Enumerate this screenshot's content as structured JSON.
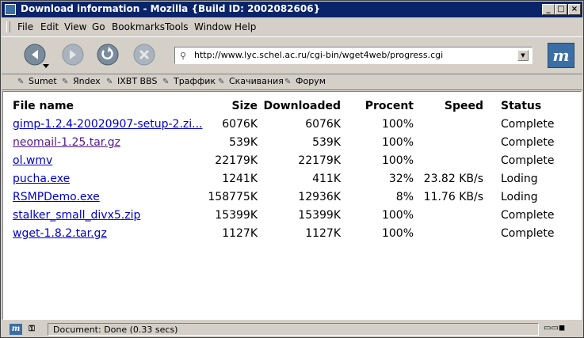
{
  "window": {
    "title": "Download information - Mozilla {Build ID: 2002082606}"
  },
  "menu": [
    "File",
    "Edit",
    "View",
    "Go",
    "Bookmarks",
    "Tools",
    "Window",
    "Help"
  ],
  "navigation": {
    "back_icon": "back-arrow-icon",
    "forward_icon": "forward-arrow-icon",
    "reload_icon": "reload-icon",
    "stop_icon": "stop-icon",
    "url": "http://www.lyc.schel.ac.ru/cgi-bin/wget4web/progress.cgi"
  },
  "bookmarks": [
    "Sumet",
    "Яndex",
    "IXBT BBS",
    "Траффик",
    "Скачивания",
    "Форум"
  ],
  "table": {
    "headers": {
      "name": "File name",
      "size": "Size",
      "downloaded": "Downloaded",
      "percent": "Procent",
      "speed": "Speed",
      "status": "Status"
    },
    "rows": [
      {
        "name": "gimp-1.2.4-20020907-setup-2.zi...",
        "size": "6076K",
        "downloaded": "6076K",
        "percent": "100%",
        "speed": "",
        "status": "Complete",
        "visited": false
      },
      {
        "name": "neomail-1.25.tar.gz",
        "size": "539K",
        "downloaded": "539K",
        "percent": "100%",
        "speed": "",
        "status": "Complete",
        "visited": true
      },
      {
        "name": "ol.wmv",
        "size": "22179K",
        "downloaded": "22179K",
        "percent": "100%",
        "speed": "",
        "status": "Complete",
        "visited": false
      },
      {
        "name": "pucha.exe",
        "size": "1241K",
        "downloaded": "411K",
        "percent": "32%",
        "speed": "23.82 KB/s",
        "status": "Loding",
        "visited": false
      },
      {
        "name": "RSMPDemo.exe",
        "size": "158775K",
        "downloaded": "12936K",
        "percent": "8%",
        "speed": "11.76 KB/s",
        "status": "Loding",
        "visited": false
      },
      {
        "name": "stalker_small_divx5.zip",
        "size": "15399K",
        "downloaded": "15399K",
        "percent": "100%",
        "speed": "",
        "status": "Complete",
        "visited": false
      },
      {
        "name": "wget-1.8.2.tar.gz",
        "size": "1127K",
        "downloaded": "1127K",
        "percent": "100%",
        "speed": "",
        "status": "Complete",
        "visited": false
      }
    ]
  },
  "statusbar": {
    "text": "Document: Done (0.33 secs)"
  },
  "colors": {
    "titlebar": "#0a246a",
    "link": "#0000cc",
    "visited_link": "#551a8b",
    "chrome": "#d4d0c8"
  }
}
